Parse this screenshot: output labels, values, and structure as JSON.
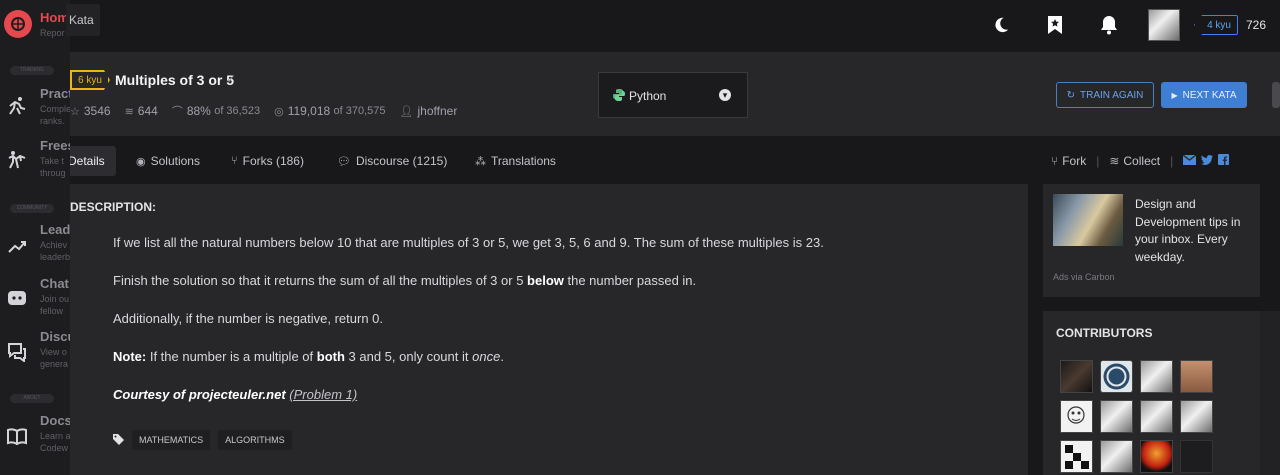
{
  "sidebar": {
    "logo": "codewars-logo",
    "kata_tab": "Kata",
    "items": [
      {
        "title": "Home",
        "desc": "Repor"
      },
      {
        "title": "Practi",
        "desc1": "Comple",
        "desc2": "ranks."
      },
      {
        "title": "Frees",
        "desc1": "Take t",
        "desc2": "throug"
      },
      {
        "title": "Leade",
        "desc1": "Achiev",
        "desc2": "leaderb"
      },
      {
        "title": "Chat",
        "desc1": "Join ou",
        "desc2": "fellow"
      },
      {
        "title": "Discu",
        "desc1": "View o",
        "desc2": "genera"
      },
      {
        "title": "Docs",
        "desc1": "Learn a",
        "desc2": "Codew"
      }
    ],
    "sections": [
      "TRAINING",
      "COMMUNITY",
      "ABOUT"
    ]
  },
  "topbar": {
    "kyu": "4 kyu",
    "honor": "726",
    "icons": [
      "moon-icon",
      "bookmark-star-icon",
      "bell-icon"
    ]
  },
  "kata": {
    "rank": "6 kyu",
    "title": "Multiples of 3 or 5",
    "stats": {
      "stars": "3546",
      "collections": "644",
      "satisfaction": "88%",
      "satisfaction_of": "of 36,523",
      "completed": "119,018",
      "completed_of": "of 370,575",
      "author": "jhoffner"
    },
    "language": "Python",
    "train_again": "TRAIN AGAIN",
    "next_kata": "NEXT KATA"
  },
  "tabs": {
    "details": "Details",
    "solutions": "Solutions",
    "forks": "Forks (186)",
    "discourse": "Discourse (1215)",
    "translations": "Translations",
    "fork": "Fork",
    "collect": "Collect"
  },
  "description": {
    "heading": "DESCRIPTION:",
    "p1": "If we list all the natural numbers below 10 that are multiples of 3 or 5, we get 3, 5, 6 and 9. The sum of these multiples is 23.",
    "p2_a": "Finish the solution so that it returns the sum of all the multiples of 3 or 5 ",
    "p2_b": "below",
    "p2_c": " the number passed in.",
    "p3": "Additionally, if the number is negative, return 0.",
    "p4_a": "Note:",
    "p4_b": " If the number is a multiple of ",
    "p4_c": "both",
    "p4_d": " 3 and 5, only count it ",
    "p4_e": "once",
    "p4_f": ".",
    "p5_a": "Courtesy of projecteuler.net",
    "p5_b": "(Problem 1)",
    "tags": [
      "MATHEMATICS",
      "ALGORITHMS"
    ]
  },
  "ad": {
    "text": "Design and Development tips in your inbox. Every weekday.",
    "via": "Ads via Carbon"
  },
  "contributors": {
    "heading": "CONTRIBUTORS"
  },
  "colors": {
    "bg": "#18181b",
    "panel": "#27272a",
    "kyu6": "#ecb613",
    "kyu4": "#3b82f6",
    "accent": "#3e7fd4",
    "logo": "#e5494d"
  }
}
